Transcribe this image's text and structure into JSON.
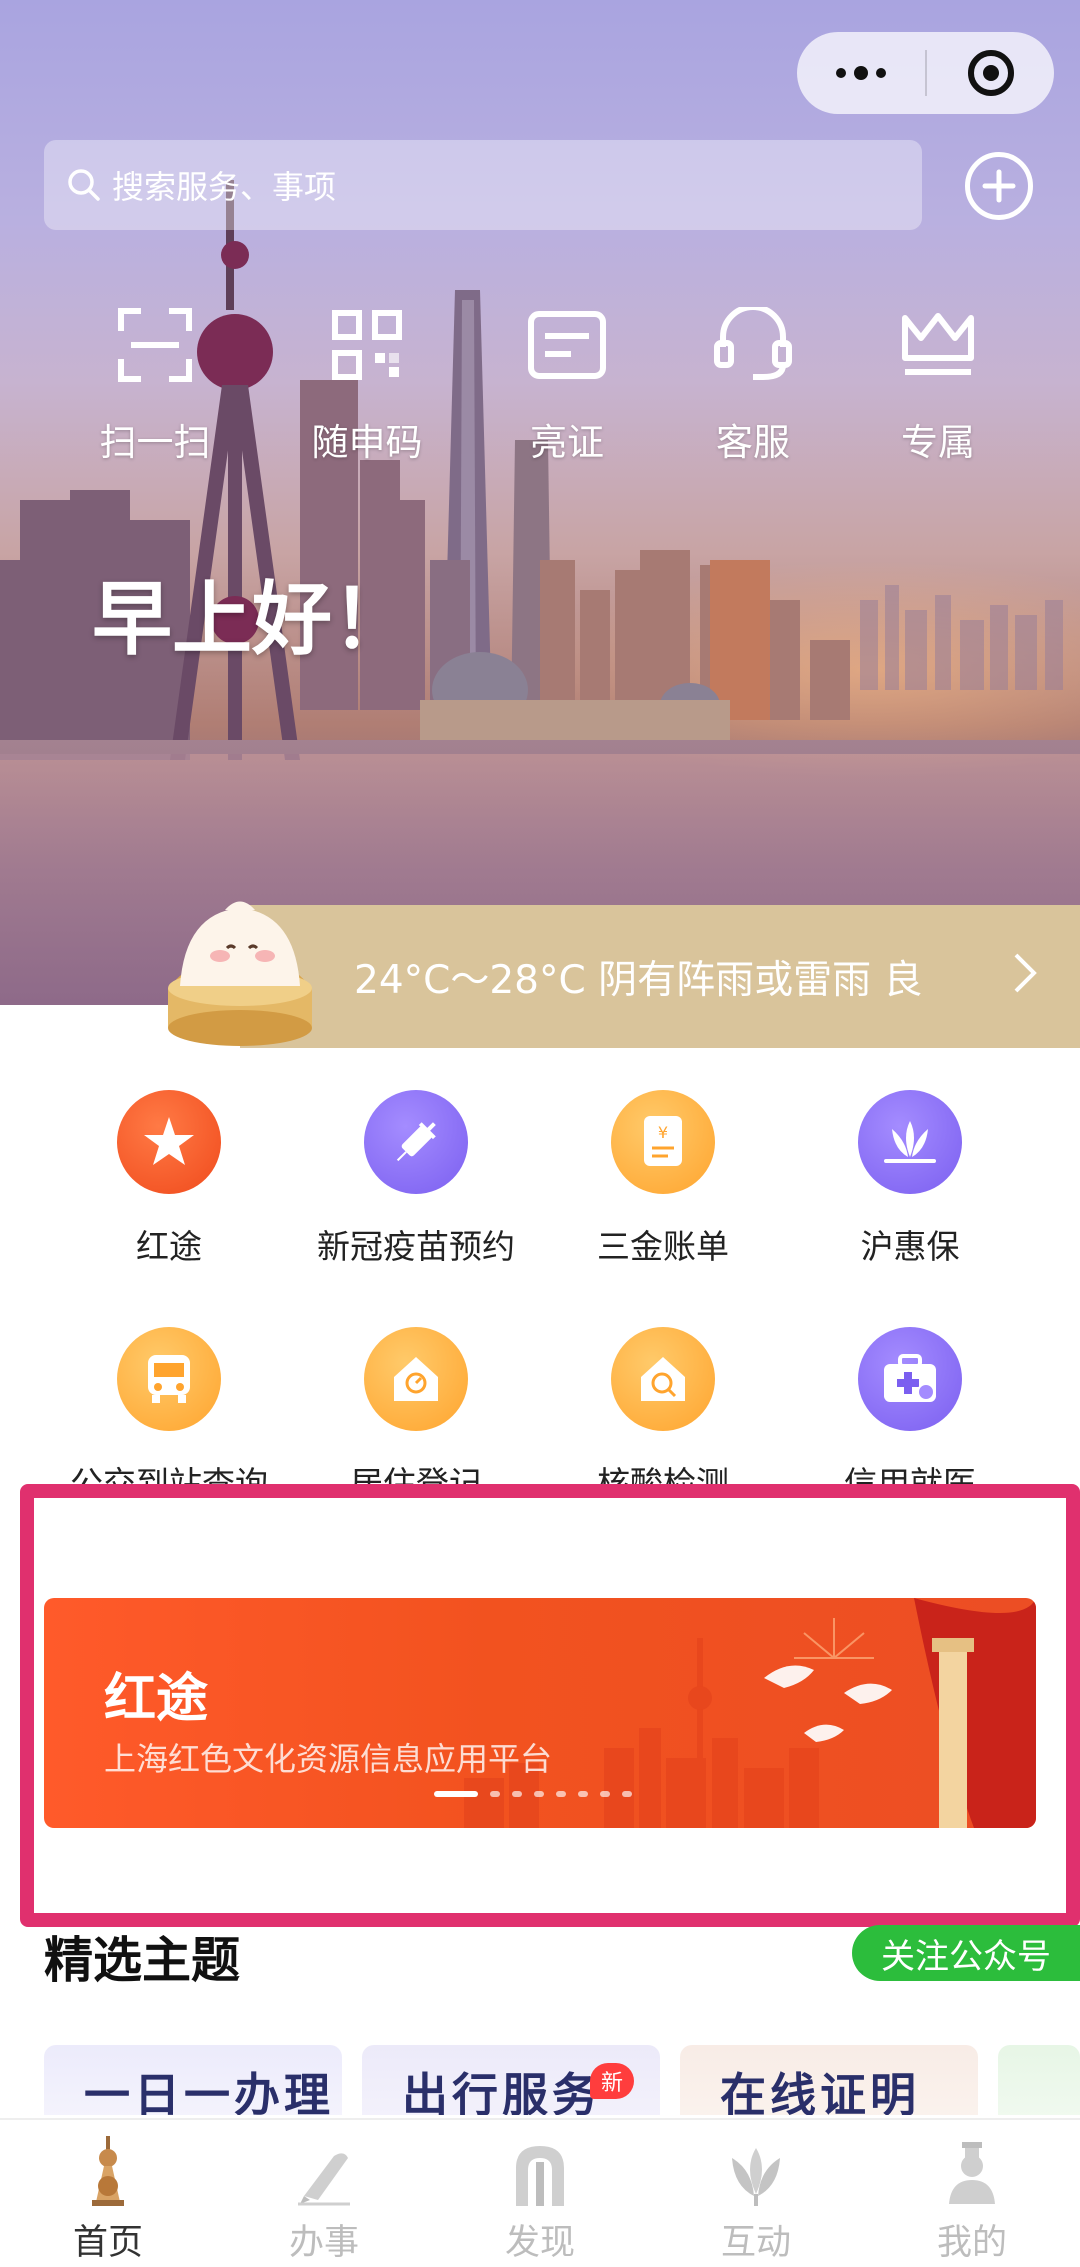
{
  "search": {
    "placeholder": "搜索服务、事项"
  },
  "quick_actions": [
    {
      "label": "扫一扫",
      "icon": "scan-icon"
    },
    {
      "label": "随申码",
      "icon": "qr-code-icon"
    },
    {
      "label": "亮证",
      "icon": "id-card-icon"
    },
    {
      "label": "客服",
      "icon": "headset-icon"
    },
    {
      "label": "专属",
      "icon": "crown-icon"
    }
  ],
  "greeting": "早上好！",
  "weather": {
    "text": "24°C～28°C 阴有阵雨或雷雨 良"
  },
  "services": [
    {
      "label": "红途",
      "icon": "red-route-icon",
      "color": "#f04a1c"
    },
    {
      "label": "新冠疫苗预约",
      "icon": "syringe-icon",
      "color": "#7b5ff0"
    },
    {
      "label": "三金账单",
      "icon": "bill-icon",
      "color": "#ffa42e"
    },
    {
      "label": "沪惠保",
      "icon": "lotus-icon",
      "color": "#7b5ff0"
    },
    {
      "label": "公交到站查询",
      "icon": "bus-icon",
      "color": "#ffa42e"
    },
    {
      "label": "居住登记",
      "icon": "house-icon",
      "color": "#ffa42e"
    },
    {
      "label": "核酸检测",
      "icon": "test-icon",
      "color": "#ffa42e"
    },
    {
      "label": "信用就医",
      "icon": "medical-kit-icon",
      "color": "#7b5ff0"
    }
  ],
  "banner": {
    "title": "红途",
    "subtitle": "上海红色文化资源信息应用平台",
    "active_index": 0,
    "slide_count": 8
  },
  "section": {
    "title": "精选主题",
    "follow_label": "关注公众号"
  },
  "cards": [
    {
      "title": "一日一办理"
    },
    {
      "title": "出行服务",
      "badge": "新"
    },
    {
      "title": "在线证明"
    }
  ],
  "tabs": [
    {
      "label": "首页",
      "icon": "home-tower-icon",
      "active": true
    },
    {
      "label": "办事",
      "icon": "pen-icon",
      "active": false
    },
    {
      "label": "发现",
      "icon": "arch-icon",
      "active": false
    },
    {
      "label": "互动",
      "icon": "magnolia-icon",
      "active": false
    },
    {
      "label": "我的",
      "icon": "person-icon",
      "active": false
    }
  ],
  "colors": {
    "accent_red": "#f04a1c",
    "highlight_border": "#e0306e",
    "wechat_green": "#2cbd3c",
    "weather_band": "#d9c49b"
  }
}
